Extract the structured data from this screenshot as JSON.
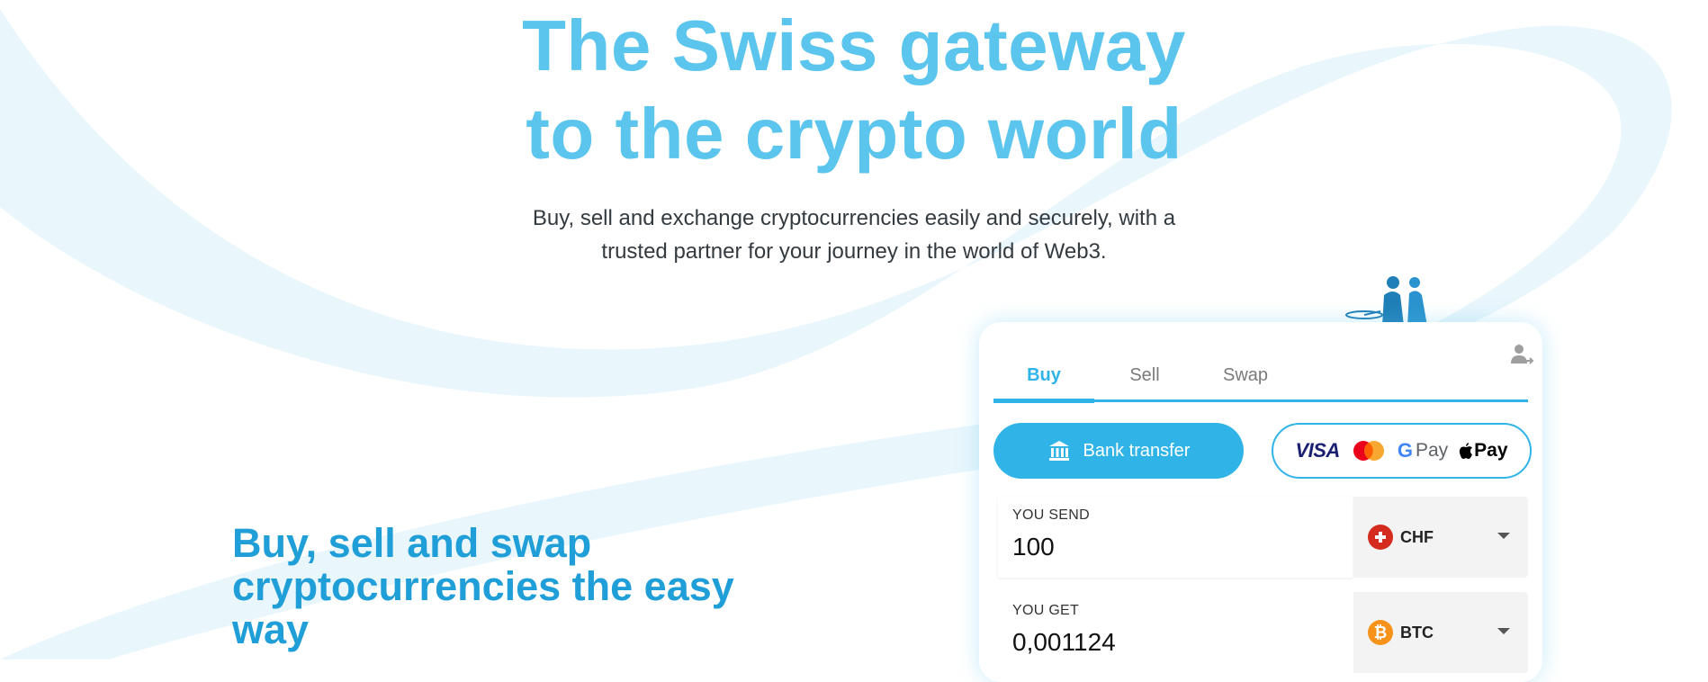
{
  "hero": {
    "title_line1": "The Swiss gateway",
    "title_line2": "to the crypto world",
    "subtitle_line1": "Buy, sell and exchange cryptocurrencies easily and securely, with a",
    "subtitle_line2": "trusted partner for your journey in the world of Web3."
  },
  "section": {
    "title": "Buy, sell and swap cryptocurrencies the easy way"
  },
  "widget": {
    "tabs": [
      {
        "label": "Buy",
        "active": true
      },
      {
        "label": "Sell",
        "active": false
      },
      {
        "label": "Swap",
        "active": false
      }
    ],
    "bank_transfer_label": "Bank transfer",
    "card_methods": {
      "visa": "VISA",
      "gpay": "Pay",
      "gpay_g": "G",
      "apple_pay": "Pay"
    },
    "send": {
      "label": "YOU SEND",
      "value": "100",
      "currency": "CHF"
    },
    "get": {
      "label": "YOU GET",
      "value": "0,001124",
      "currency": "BTC"
    }
  },
  "colors": {
    "accent": "#30b4e8",
    "hero_title": "#5bc5ee",
    "section_title": "#1f9ed8",
    "chf_flag": "#d52b1e",
    "btc": "#f7931a"
  },
  "icons": {
    "bank": "bank-icon",
    "account": "account-switch-icon",
    "mastercard": "mastercard-icon",
    "apple": "apple-icon",
    "chf": "swiss-flag-icon",
    "btc": "bitcoin-icon"
  }
}
